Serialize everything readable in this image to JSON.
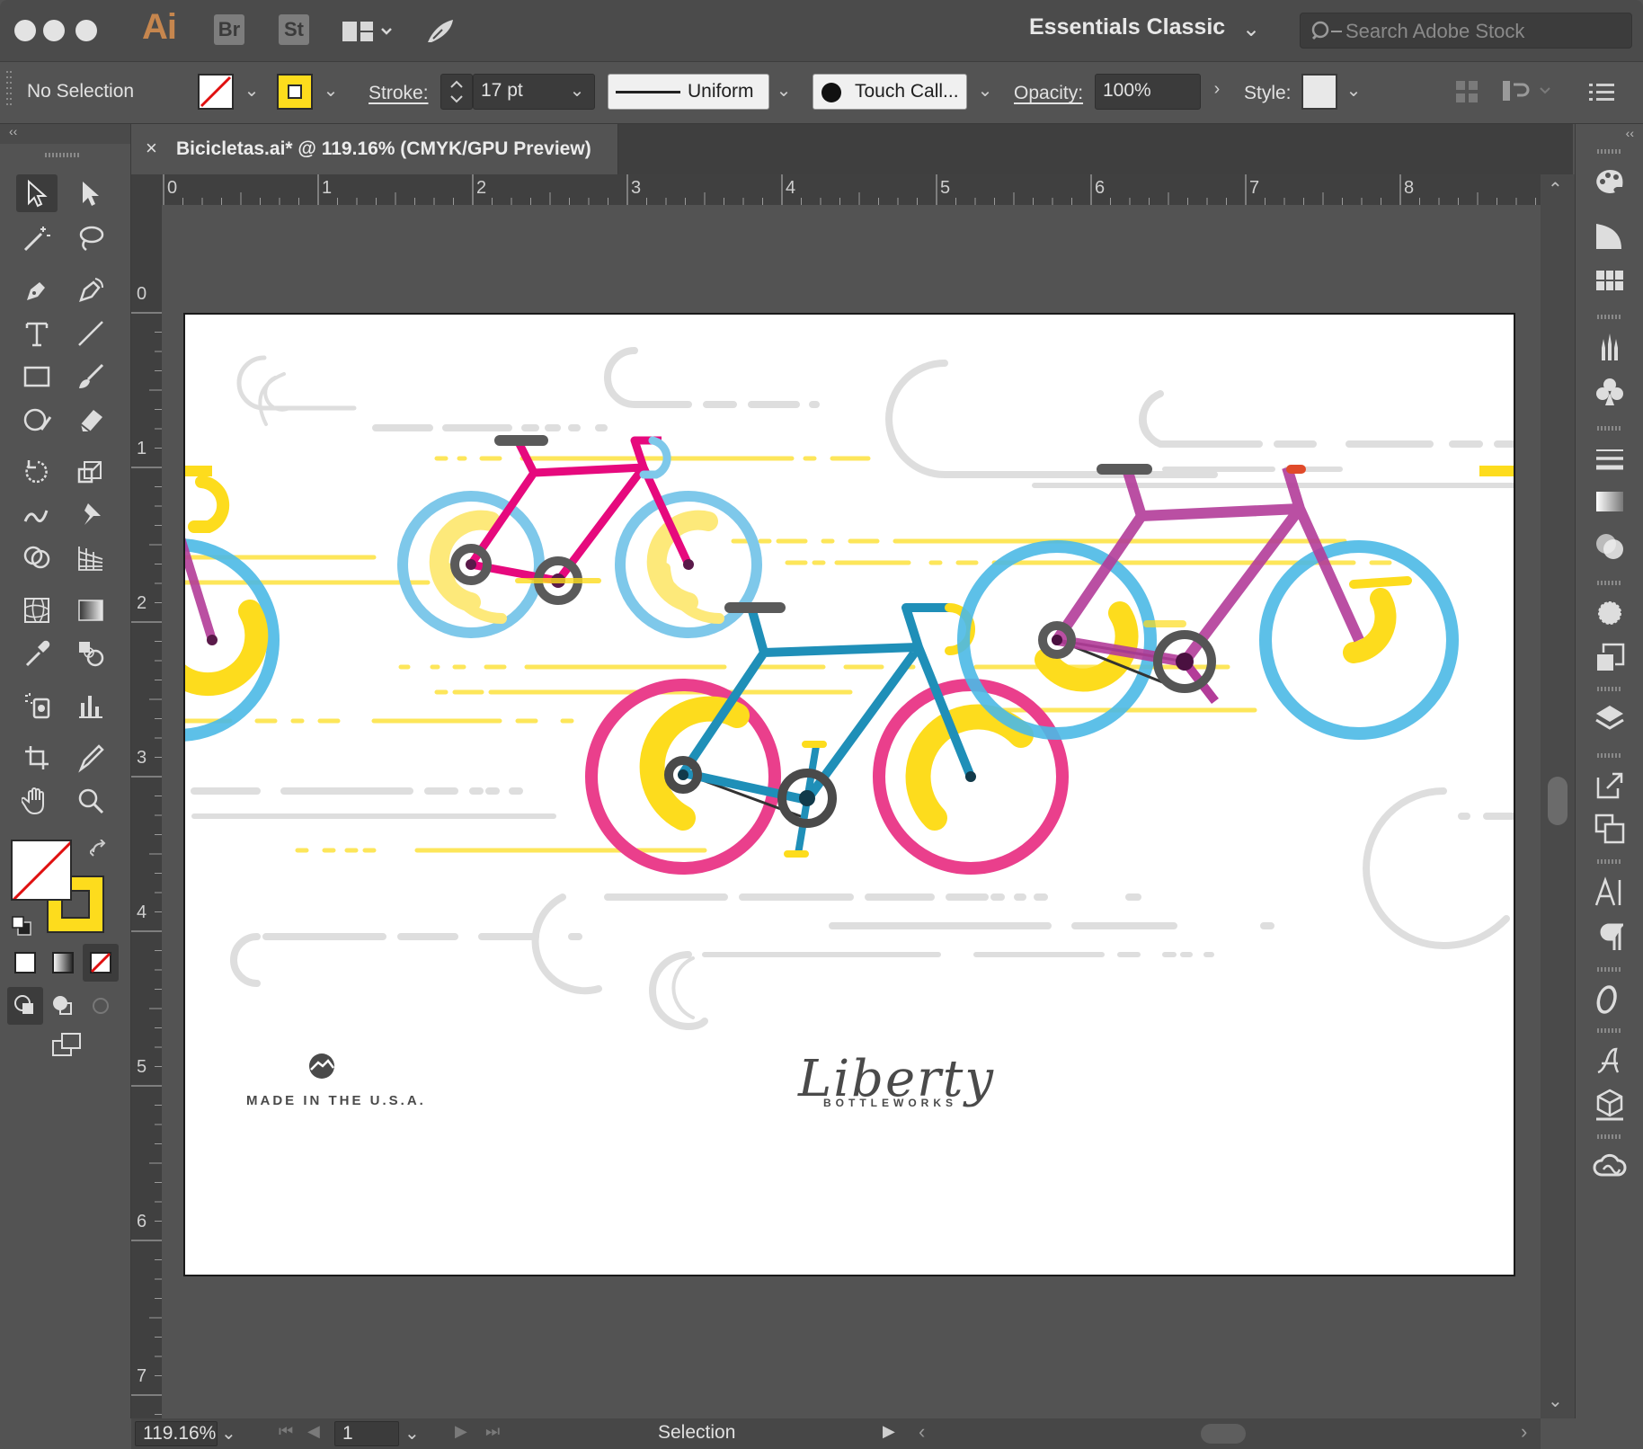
{
  "app": {
    "logo": "Ai",
    "bridge_label": "Br",
    "stock_app_label": "St",
    "workspace": "Essentials Classic",
    "search_placeholder": "Search Adobe Stock"
  },
  "control_bar": {
    "selection_state": "No Selection",
    "stroke_label": "Stroke:",
    "stroke_weight": "17 pt",
    "profile_label": "Uniform",
    "brush_label": "Touch Call...",
    "opacity_label": "Opacity:",
    "opacity_value": "100%",
    "style_label": "Style:"
  },
  "document": {
    "tab_title": "Bicicletas.ai* @ 119.16% (CMYK/GPU Preview)",
    "close_glyph": "×"
  },
  "rulers": {
    "top": [
      "0",
      "1",
      "2",
      "3",
      "4",
      "5",
      "6",
      "7",
      "8"
    ],
    "left": [
      "0",
      "1",
      "2",
      "3",
      "4",
      "5",
      "6",
      "7"
    ]
  },
  "artwork": {
    "made_in": "MADE IN THE U.S.A.",
    "brand_script": "Liberty",
    "brand_sub": "BOTTLEWORKS"
  },
  "status_bar": {
    "zoom": "119.16%",
    "artboard_number": "1",
    "mode": "Selection"
  },
  "colors": {
    "magenta": "#e6097d",
    "cyan": "#3fb6e6",
    "yellow": "#fddc1d",
    "teal": "#1f8fb8",
    "pink": "#ea3f8c",
    "purple": "#b33c99",
    "gray_speed": "#d9d9d9",
    "dark": "#505050"
  }
}
